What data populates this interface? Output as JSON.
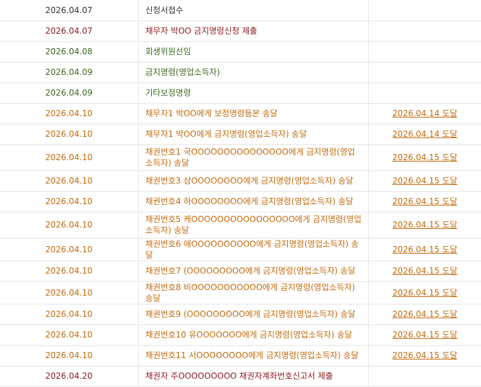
{
  "rows": [
    {
      "date": "2026.04.07",
      "content": "신청서접수",
      "result": "",
      "color": "#333333",
      "height": 30
    },
    {
      "date": "2026.04.07",
      "content": "채무자 박OO 금지명령신청 제출",
      "result": "",
      "color": "#8b1a1a",
      "height": 30
    },
    {
      "date": "2026.04.08",
      "content": "회생위원선임",
      "result": "",
      "color": "#3a6a1d",
      "height": 30
    },
    {
      "date": "2026.04.09",
      "content": "금지명령(영업소득자)",
      "result": "",
      "color": "#3a6a1d",
      "height": 30
    },
    {
      "date": "2026.04.09",
      "content": "기타보정명령",
      "result": "",
      "color": "#3a6a1d",
      "height": 30
    },
    {
      "date": "2026.04.10",
      "content": "채무자1 박OO에게 보정명령등본 송달",
      "result": "2026.04.14 도달",
      "color": "#c26a0c",
      "height": 30
    },
    {
      "date": "2026.04.10",
      "content": "채무자1 박OO에게 금지명령(영업소득자) 송달",
      "result": "2026.04.14 도달",
      "color": "#c26a0c",
      "height": 30
    },
    {
      "date": "2026.04.10",
      "content": "채권번호1 국OOOOOOOOOOOOOOO에게 금지명령(영업소득자) 송달",
      "result": "2026.04.15 도달",
      "color": "#c26a0c",
      "height": 38
    },
    {
      "date": "2026.04.10",
      "content": "채권번호3 삼OOOOOOOO에게 금지명령(영업소득자) 송달",
      "result": "2026.04.15 도달",
      "color": "#c26a0c",
      "height": 30
    },
    {
      "date": "2026.04.10",
      "content": "채권번호4 하OOOOOOOO에게 금지명령(영업소득자) 송달",
      "result": "2026.04.15 도달",
      "color": "#c26a0c",
      "height": 30
    },
    {
      "date": "2026.04.10",
      "content": "채권번호5 케OOOOOOOOOOOOOOOO에게 금지명령(영업소득자) 송달",
      "result": "2026.04.15 도달",
      "color": "#c26a0c",
      "height": 38
    },
    {
      "date": "2026.04.10",
      "content": "채권번호6 애OOOOOOOOOO에게 금지명령(영업소득자) 송달",
      "result": "2026.04.15 도달",
      "color": "#c26a0c",
      "height": 30
    },
    {
      "date": "2026.04.10",
      "content": "채권번호7 (OOOOOOOOO에게 금지명령(영업소득자) 송달",
      "result": "2026.04.15 도달",
      "color": "#c26a0c",
      "height": 30
    },
    {
      "date": "2026.04.10",
      "content": "채권번호8 비OOOOOOOOOOO에게 금지명령(영업소득자) 송달",
      "result": "2026.04.15 도달",
      "color": "#c26a0c",
      "height": 30
    },
    {
      "date": "2026.04.10",
      "content": "채권번호9 (OOOOOOOOO에게 금지명령(영업소득자) 송달",
      "result": "2026.04.15 도달",
      "color": "#c26a0c",
      "height": 30
    },
    {
      "date": "2026.04.10",
      "content": "채권번호10 유OOOOOOO에게 금지명령(영업소득자) 송달",
      "result": "2026.04.15 도달",
      "color": "#c26a0c",
      "height": 30
    },
    {
      "date": "2026.04.10",
      "content": "채권번호11 서OOOOOOOO에게 금지명령(영업소득자) 송달",
      "result": "2026.04.15 도달",
      "color": "#c26a0c",
      "height": 30
    },
    {
      "date": "2026.04.20",
      "content": "채권자 주OOOOOOOOO 채권자계좌번호신고서 제출",
      "result": "",
      "color": "#8b1a1a",
      "height": 30
    }
  ]
}
